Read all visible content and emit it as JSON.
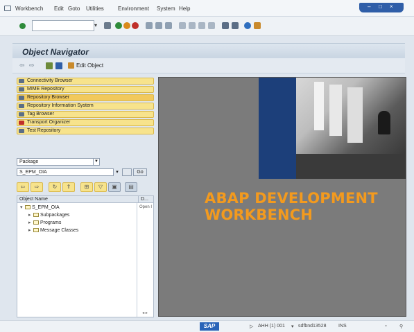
{
  "menu": {
    "items": [
      "Workbench",
      "Edit",
      "Goto",
      "Utilities",
      "Environment",
      "System",
      "Help"
    ]
  },
  "toolbar": {
    "command_value": "",
    "icons": [
      "save-icon",
      "back-icon",
      "exit-icon",
      "cancel-icon",
      "print-icon",
      "find-icon",
      "find-next-icon",
      "first-page-icon",
      "previous-page-icon",
      "next-page-icon",
      "last-page-icon",
      "new-session-icon",
      "shortcut-icon",
      "help-icon",
      "customize-layout-icon"
    ]
  },
  "header": {
    "title": "Object Navigator"
  },
  "app_toolbar": {
    "edit_object_label": "Edit Object"
  },
  "sidebar": {
    "items": [
      {
        "label": "Connectivity Browser"
      },
      {
        "label": "MIME Repository"
      },
      {
        "label": "Repository Browser"
      },
      {
        "label": "Repository Information System"
      },
      {
        "label": "Tag Browser"
      },
      {
        "label": "Transport Organizer"
      },
      {
        "label": "Test Repository"
      }
    ],
    "active_index": 2
  },
  "object_selector": {
    "type_value": "Package",
    "name_value": "S_EPM_OIA",
    "go_label": "Go"
  },
  "tree": {
    "columns": [
      "Object Name",
      "D..."
    ],
    "root": {
      "name": "S_EPM_OIA",
      "desc": "Open I"
    },
    "children": [
      "Subpackages",
      "Programs",
      "Message Classes"
    ],
    "scroll_label": "◂ ▸"
  },
  "welcome": {
    "title_line1": "ABAP DEVELOPMENT",
    "title_line2": "WORKBENCH",
    "title_color": "#f39a1e"
  },
  "status": {
    "logo": "SAP",
    "system": "AHH (1) 001",
    "server": "sdfbnd13528",
    "mode": "INS"
  }
}
